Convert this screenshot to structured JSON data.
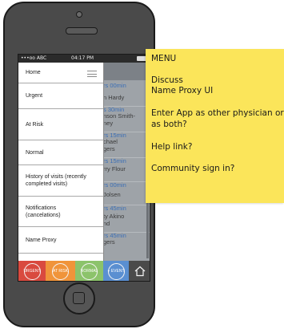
{
  "statusbar": {
    "carrier": "•••oo ABC",
    "time": "04:17 PM"
  },
  "colors": {
    "urgent": "#d94a3f",
    "at_risk": "#f0943a",
    "normal": "#8cc36b",
    "event": "#5a8fd1",
    "note": "#fbe55a"
  },
  "menu": {
    "items": [
      {
        "label": "Home"
      },
      {
        "label": "Urgent"
      },
      {
        "label": "At Risk"
      },
      {
        "label": "Normal"
      },
      {
        "label": "History of visits (recently completed visits)"
      },
      {
        "label": "Notifications (cancelations)"
      },
      {
        "label": "Name Proxy"
      }
    ]
  },
  "background_list": {
    "rows": [
      {
        "text": "rs 00min",
        "style": "blue"
      },
      {
        "text": "n Hardy",
        "style": "plain"
      },
      {
        "text": "s 30min",
        "style": "blue"
      },
      {
        "text": "nson Smith-",
        "style": "plain"
      },
      {
        "text": "ney",
        "style": "plain"
      },
      {
        "text": "rs 15min",
        "style": "blue"
      },
      {
        "text": "chael",
        "style": "plain"
      },
      {
        "text": "gers",
        "style": "plain"
      },
      {
        "text": "rs 15min",
        "style": "blue"
      },
      {
        "text": "rry Flour",
        "style": "plain"
      },
      {
        "text": "rs 00min",
        "style": "blue"
      },
      {
        "text": "Jolsen",
        "style": "plain"
      },
      {
        "text": "rs 45min",
        "style": "blue"
      },
      {
        "text": "ty Akino",
        "style": "plain"
      },
      {
        "text": "nd",
        "style": "plain"
      },
      {
        "text": "rs 45min",
        "style": "blue"
      },
      {
        "text": "gers",
        "style": "plain"
      }
    ]
  },
  "tabs": {
    "urgent": "URGENT",
    "at_risk": "AT RISK",
    "normal": "NORMAL",
    "event": "+ EVENT"
  },
  "note": {
    "lines": [
      "MENU",
      "Discuss",
      "Name Proxy UI",
      "Enter App as other physician or",
      "as both?",
      "Help link?",
      "Community sign in?"
    ]
  }
}
